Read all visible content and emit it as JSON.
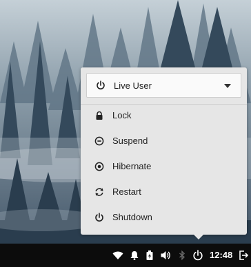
{
  "menu": {
    "user": {
      "label": "Live User",
      "icon": "power-icon"
    },
    "items": [
      {
        "label": "Lock",
        "icon": "lock-icon"
      },
      {
        "label": "Suspend",
        "icon": "suspend-icon"
      },
      {
        "label": "Hibernate",
        "icon": "hibernate-icon"
      },
      {
        "label": "Restart",
        "icon": "restart-icon"
      },
      {
        "label": "Shutdown",
        "icon": "power-icon"
      }
    ]
  },
  "taskbar": {
    "clock": "12:48",
    "tray_icons": [
      "wifi-icon",
      "bell-icon",
      "battery-icon",
      "volume-icon",
      "bluetooth-icon",
      "power-icon",
      "logout-icon"
    ]
  },
  "colors": {
    "menu_bg": "#e6e6e6",
    "taskbar_bg": "#0c0c0c"
  }
}
